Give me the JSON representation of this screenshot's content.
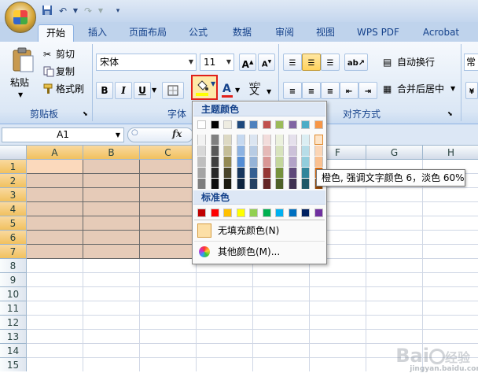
{
  "tabs": [
    "开始",
    "插入",
    "页面布局",
    "公式",
    "数据",
    "审阅",
    "视图",
    "WPS PDF",
    "Acrobat"
  ],
  "clipboard": {
    "paste": "粘贴",
    "cut": "剪切",
    "copy": "复制",
    "format_painter": "格式刷",
    "group_label": "剪贴板"
  },
  "font": {
    "name": "宋体",
    "size": "11",
    "bold": "B",
    "italic": "I",
    "underline": "U",
    "grow": "A",
    "shrink": "A",
    "wen_top": "wén",
    "wen": "文",
    "group_label": "字体"
  },
  "alignment": {
    "wrap_text": "自动换行",
    "merge_center": "合并后居中",
    "group_label": "对齐方式",
    "number_partial": "常"
  },
  "namebox": "A1",
  "fx": "fx",
  "columns": [
    "A",
    "B",
    "C",
    "D",
    "E",
    "F",
    "G",
    "H"
  ],
  "rows": [
    "1",
    "2",
    "3",
    "4",
    "5",
    "6",
    "7",
    "8",
    "9",
    "10",
    "11",
    "12",
    "13",
    "14",
    "15",
    "16"
  ],
  "dropdown": {
    "theme_title": "主题颜色",
    "standard_title": "标准色",
    "no_fill": "无填充颜色(N)",
    "more_colors": "其他颜色(M)...",
    "theme_top": [
      "#ffffff",
      "#000000",
      "#eeece1",
      "#1f497d",
      "#4f81bd",
      "#c0504d",
      "#9bbb59",
      "#8064a2",
      "#4bacc6",
      "#f79646"
    ],
    "theme_shades": [
      [
        "#f2f2f2",
        "#7f7f7f",
        "#ddd9c3",
        "#c6d9f0",
        "#dbe5f1",
        "#f2dcdb",
        "#ebf1dd",
        "#e5e0ec",
        "#dbeef3",
        "#fdeada"
      ],
      [
        "#d8d8d8",
        "#595959",
        "#c4bd97",
        "#8db3e2",
        "#b8cce4",
        "#e5b9b7",
        "#d7e3bc",
        "#ccc1d9",
        "#b7dde8",
        "#fbd5b5"
      ],
      [
        "#bfbfbf",
        "#3f3f3f",
        "#938953",
        "#548dd4",
        "#95b3d7",
        "#d99694",
        "#c3d69b",
        "#b2a2c7",
        "#92cddc",
        "#fac08f"
      ],
      [
        "#a5a5a5",
        "#262626",
        "#494429",
        "#17365d",
        "#366092",
        "#953734",
        "#76923c",
        "#5f497a",
        "#31859b",
        "#e36c09"
      ],
      [
        "#7f7f7f",
        "#0c0c0c",
        "#1d1b10",
        "#0f243e",
        "#244061",
        "#632423",
        "#4f6128",
        "#3f3151",
        "#205867",
        "#974806"
      ]
    ],
    "standard": [
      "#c00000",
      "#ff0000",
      "#ffc000",
      "#ffff00",
      "#92d050",
      "#00b050",
      "#00b0f0",
      "#0070c0",
      "#002060",
      "#7030a0"
    ]
  },
  "tooltip": "橙色, 强调文字颜色 6，淡色 60%",
  "fill_color": "#e6cbb8",
  "watermark": {
    "main": "Bai",
    "sub": "jingyan.baidu.com"
  }
}
